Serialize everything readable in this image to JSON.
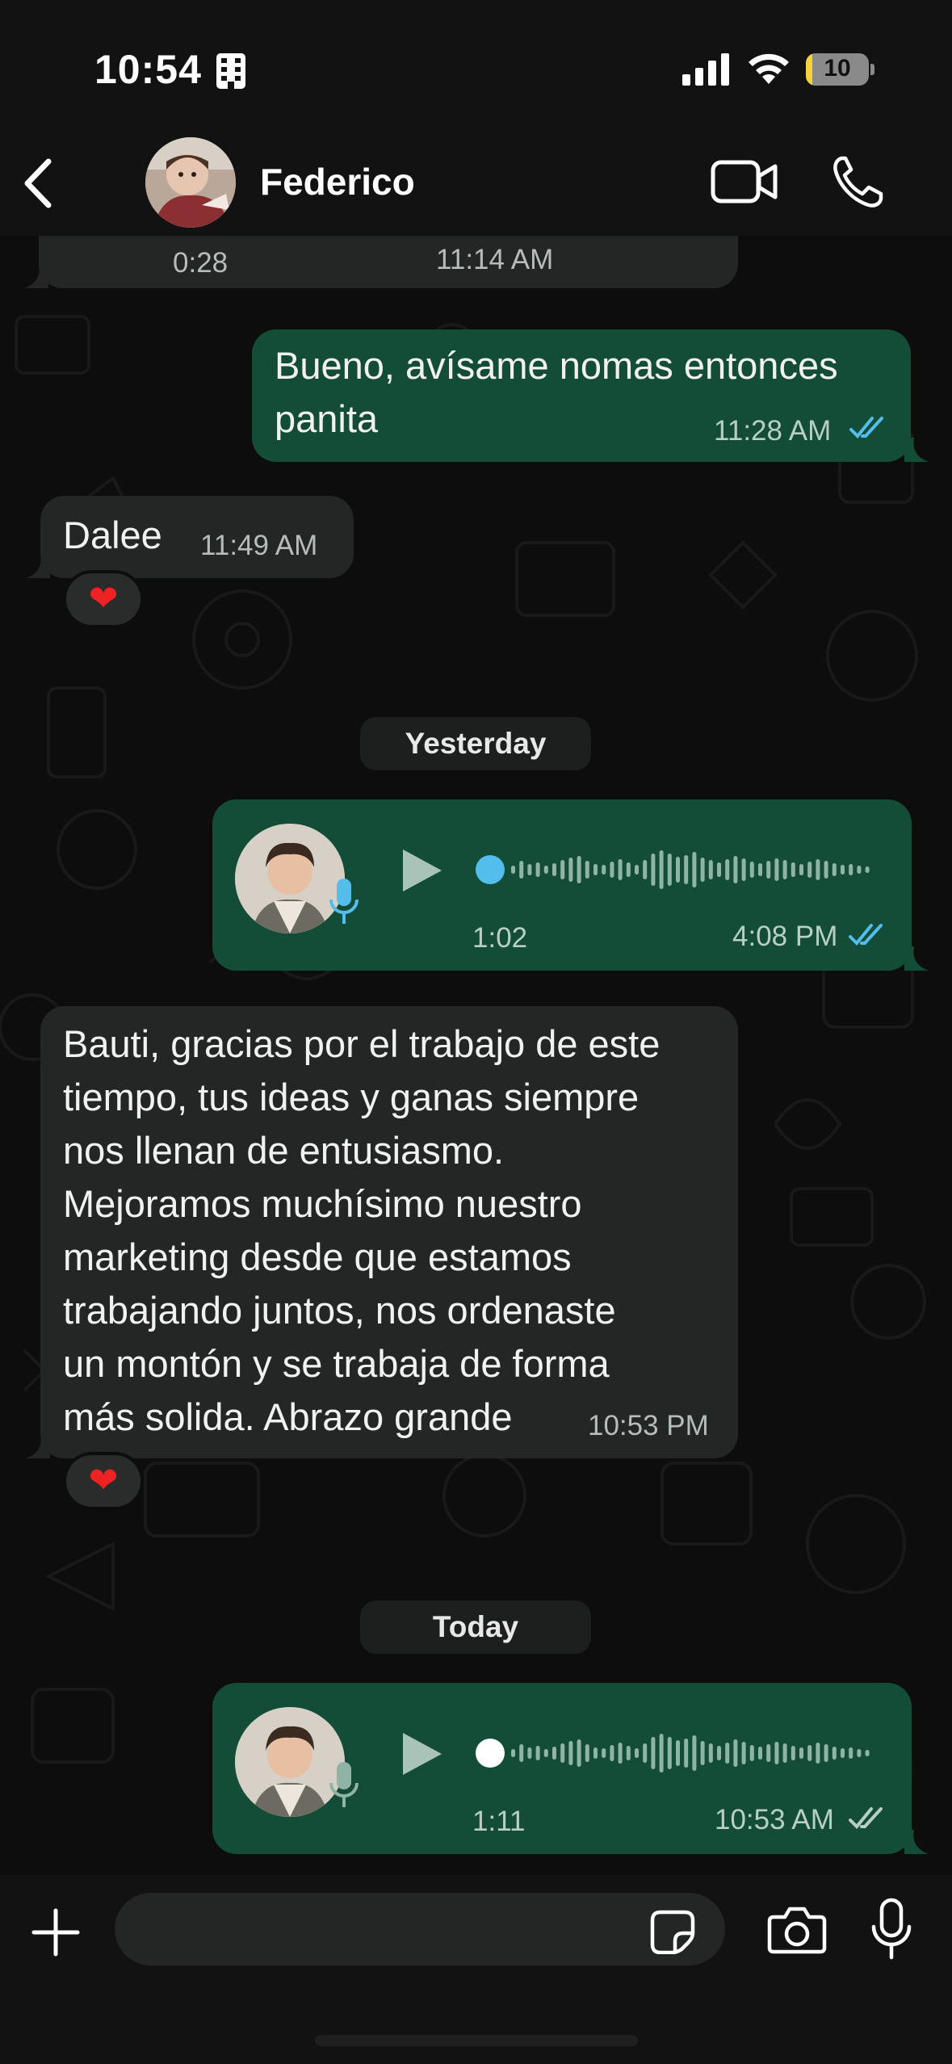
{
  "status_bar": {
    "time": "10:54",
    "battery": "10",
    "battery_level": 0.1
  },
  "header": {
    "contact_name": "Federico"
  },
  "messages": [
    {
      "dir": "in",
      "type": "voice-partial",
      "duration": "0:28",
      "time": "11:14 AM"
    },
    {
      "dir": "out",
      "type": "text",
      "lines": [
        "Bueno, avísame nomas entonces",
        "panita"
      ],
      "time": "11:28 AM"
    },
    {
      "dir": "in",
      "type": "text",
      "lines": [
        "Dalee"
      ],
      "time": "11:49 AM",
      "reaction": "❤"
    },
    {
      "type": "date",
      "label": "Yesterday"
    },
    {
      "dir": "out",
      "type": "voice",
      "duration": "1:02",
      "time": "4:08 PM"
    },
    {
      "dir": "in",
      "type": "text",
      "lines": [
        "Bauti, gracias por el trabajo de este",
        "tiempo, tus ideas y ganas siempre",
        "nos llenan de entusiasmo.",
        "Mejoramos muchísimo nuestro",
        "marketing desde que estamos",
        "trabajando juntos, nos ordenaste",
        "un montón y se trabaja de forma",
        "más solida. Abrazo grande"
      ],
      "time": "10:53 PM",
      "reaction": "❤"
    },
    {
      "type": "date",
      "label": "Today"
    },
    {
      "dir": "out",
      "type": "voice",
      "duration": "1:11",
      "time": "10:53 AM"
    }
  ],
  "colors": {
    "outgoing": "#144d37",
    "incoming": "#242626",
    "read_ticks": "#53bdeb",
    "sent_ticks": "#b8cfc5"
  },
  "icons": [
    "back-icon",
    "video-call-icon",
    "phone-icon",
    "plus-icon",
    "sticker-icon",
    "camera-icon",
    "mic-icon",
    "play-icon"
  ]
}
